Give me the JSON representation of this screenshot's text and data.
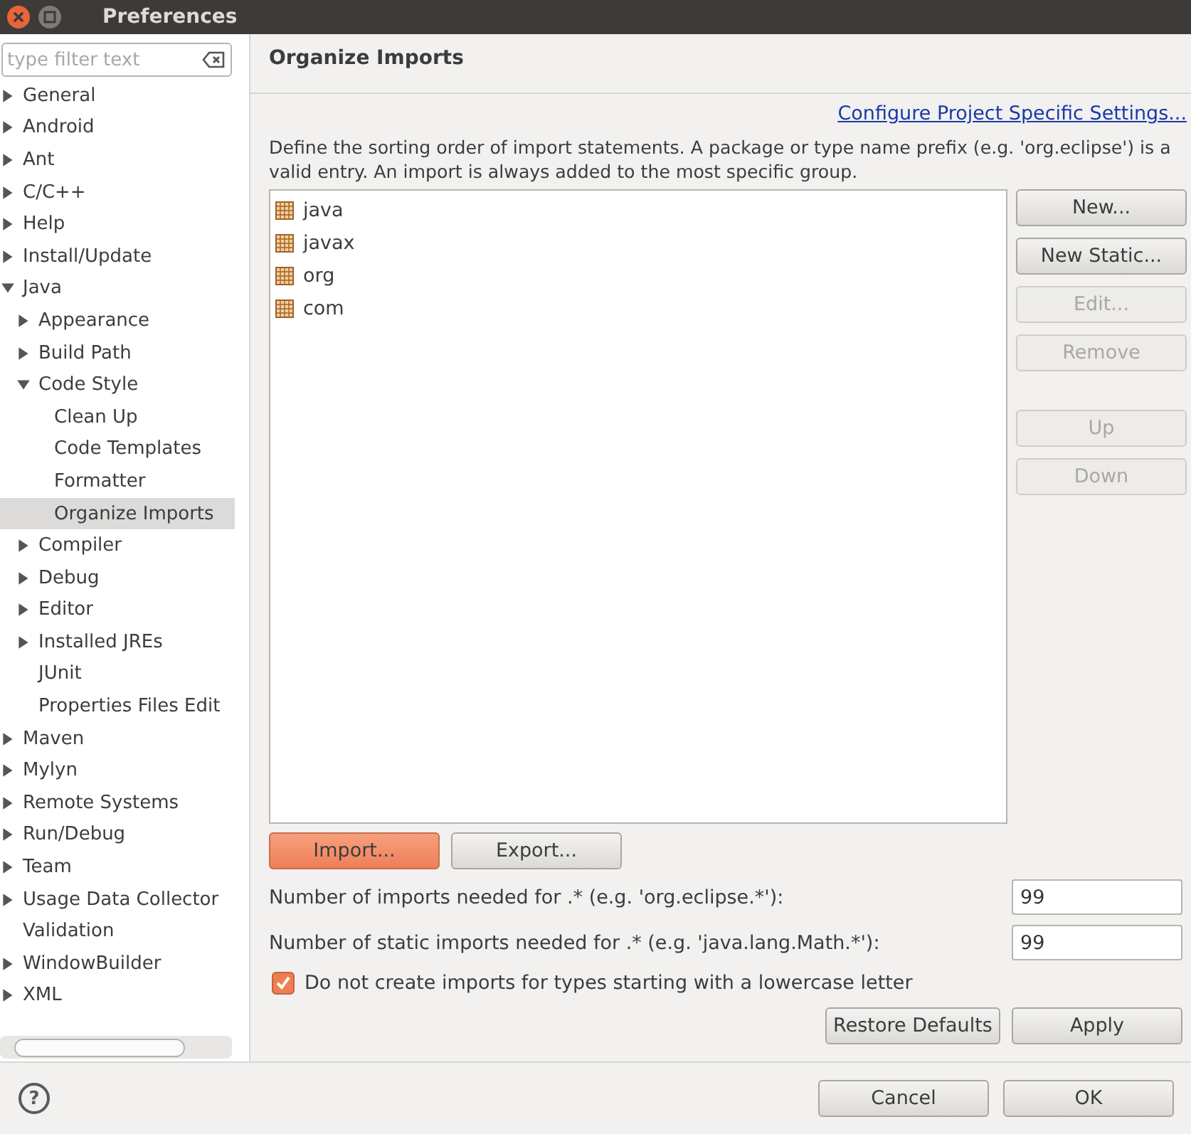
{
  "window": {
    "title": "Preferences"
  },
  "sidebar": {
    "filter": {
      "placeholder": "type filter text"
    },
    "items": [
      {
        "label": "General",
        "kind": "node",
        "expanded": false,
        "selected": false
      },
      {
        "label": "Android",
        "kind": "node",
        "expanded": false,
        "selected": false
      },
      {
        "label": "Ant",
        "kind": "node",
        "expanded": false,
        "selected": false
      },
      {
        "label": "C/C++",
        "kind": "node",
        "expanded": false,
        "selected": false
      },
      {
        "label": "Help",
        "kind": "node",
        "expanded": false,
        "selected": false
      },
      {
        "label": "Install/Update",
        "kind": "node",
        "expanded": false,
        "selected": false
      },
      {
        "label": "Java",
        "kind": "node",
        "expanded": true,
        "selected": false,
        "children": [
          {
            "label": "Appearance",
            "kind": "node",
            "expanded": false,
            "selected": false
          },
          {
            "label": "Build Path",
            "kind": "node",
            "expanded": false,
            "selected": false
          },
          {
            "label": "Code Style",
            "kind": "node",
            "expanded": true,
            "selected": false,
            "children": [
              {
                "label": "Clean Up",
                "kind": "leaf",
                "selected": false
              },
              {
                "label": "Code Templates",
                "kind": "leaf",
                "selected": false
              },
              {
                "label": "Formatter",
                "kind": "leaf",
                "selected": false
              },
              {
                "label": "Organize Imports",
                "kind": "leaf",
                "selected": true
              }
            ]
          },
          {
            "label": "Compiler",
            "kind": "node",
            "expanded": false,
            "selected": false
          },
          {
            "label": "Debug",
            "kind": "node",
            "expanded": false,
            "selected": false
          },
          {
            "label": "Editor",
            "kind": "node",
            "expanded": false,
            "selected": false
          },
          {
            "label": "Installed JREs",
            "kind": "node",
            "expanded": false,
            "selected": false
          },
          {
            "label": "JUnit",
            "kind": "leaf",
            "selected": false
          },
          {
            "label": "Properties Files Edit",
            "kind": "leaf",
            "selected": false
          }
        ]
      },
      {
        "label": "Maven",
        "kind": "node",
        "expanded": false,
        "selected": false
      },
      {
        "label": "Mylyn",
        "kind": "node",
        "expanded": false,
        "selected": false
      },
      {
        "label": "Remote Systems",
        "kind": "node",
        "expanded": false,
        "selected": false
      },
      {
        "label": "Run/Debug",
        "kind": "node",
        "expanded": false,
        "selected": false
      },
      {
        "label": "Team",
        "kind": "node",
        "expanded": false,
        "selected": false
      },
      {
        "label": "Usage Data Collector",
        "kind": "node",
        "expanded": false,
        "selected": false
      },
      {
        "label": "Validation",
        "kind": "leaf",
        "selected": false
      },
      {
        "label": "WindowBuilder",
        "kind": "node",
        "expanded": false,
        "selected": false
      },
      {
        "label": "XML",
        "kind": "node",
        "expanded": false,
        "selected": false
      }
    ]
  },
  "page": {
    "title": "Organize Imports",
    "link": "Configure Project Specific Settings...",
    "description": "Define the sorting order of import statements. A package or type name prefix (e.g. 'org.eclipse') is a valid entry. An import is always added to the most specific group.",
    "groups": [
      "java",
      "javax",
      "org",
      "com"
    ],
    "side_buttons": [
      {
        "label": "New...",
        "disabled": false
      },
      {
        "label": "New Static...",
        "disabled": false
      },
      {
        "label": "Edit...",
        "disabled": true
      },
      {
        "label": "Remove",
        "disabled": true
      },
      {
        "label": "Up",
        "disabled": true
      },
      {
        "label": "Down",
        "disabled": true
      }
    ],
    "import_button": "Import...",
    "export_button": "Export...",
    "fields": [
      {
        "label": "Number of imports needed for .* (e.g. 'org.eclipse.*'):",
        "value": "99"
      },
      {
        "label": "Number of static imports needed for .* (e.g. 'java.lang.Math.*'):",
        "value": "99"
      }
    ],
    "checkbox": {
      "label": "Do not create imports for types starting with a lowercase letter",
      "checked": true
    },
    "restore_button": "Restore Defaults",
    "apply_button": "Apply"
  },
  "footer": {
    "help": "?",
    "buttons": [
      "Cancel",
      "OK"
    ]
  }
}
